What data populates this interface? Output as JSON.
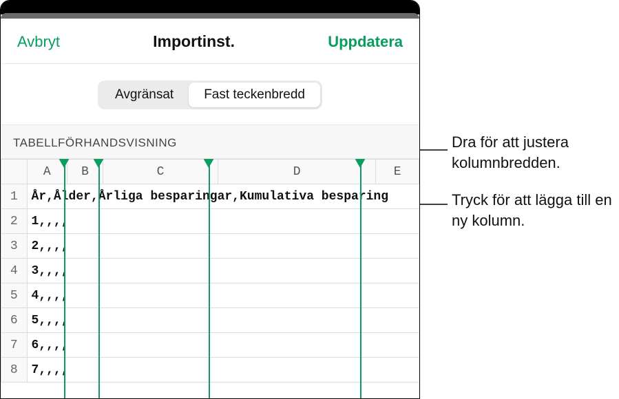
{
  "header": {
    "cancel": "Avbryt",
    "title": "Importinst.",
    "update": "Uppdatera"
  },
  "tabs": {
    "delimited": "Avgränsat",
    "fixed": "Fast teckenbredd"
  },
  "section": {
    "preview_label": "TABELLFÖRHANDSVISNING"
  },
  "columns": [
    "A",
    "B",
    "C",
    "D",
    "E"
  ],
  "rows": [
    {
      "n": "1",
      "text": "År,Ålder,Årliga besparingar,Kumulativa besparing"
    },
    {
      "n": "2",
      "text": "1,,,,"
    },
    {
      "n": "3",
      "text": "2,,,,"
    },
    {
      "n": "4",
      "text": "3,,,,"
    },
    {
      "n": "5",
      "text": "4,,,,"
    },
    {
      "n": "6",
      "text": "5,,,,"
    },
    {
      "n": "7",
      "text": "6,,,,"
    },
    {
      "n": "8",
      "text": "7,,,,"
    }
  ],
  "callouts": {
    "drag": "Dra för att justera kolumnbredden.",
    "tap": "Tryck för att lägga till en ny kolumn."
  }
}
